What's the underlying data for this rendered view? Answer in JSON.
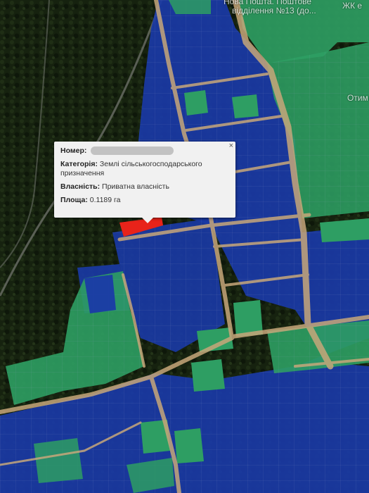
{
  "map": {
    "labels": {
      "poi_line1": "Нова Пошта. Поштове",
      "poi_line2": "відділення №13 (до...",
      "complex": "ЖК е",
      "partial": "Отим"
    },
    "colors": {
      "private_parcel": "#1a3aa6",
      "state_parcel": "#2e9e63",
      "selected_parcel": "#e8231a"
    }
  },
  "popup": {
    "number_label": "Номер:",
    "category_label": "Категорія:",
    "category_value": "Землі сільськогосподарського призначення",
    "ownership_label": "Власність:",
    "ownership_value": "Приватна власність",
    "area_label": "Площа:",
    "area_value": "0.1189 га",
    "close_symbol": "×"
  }
}
